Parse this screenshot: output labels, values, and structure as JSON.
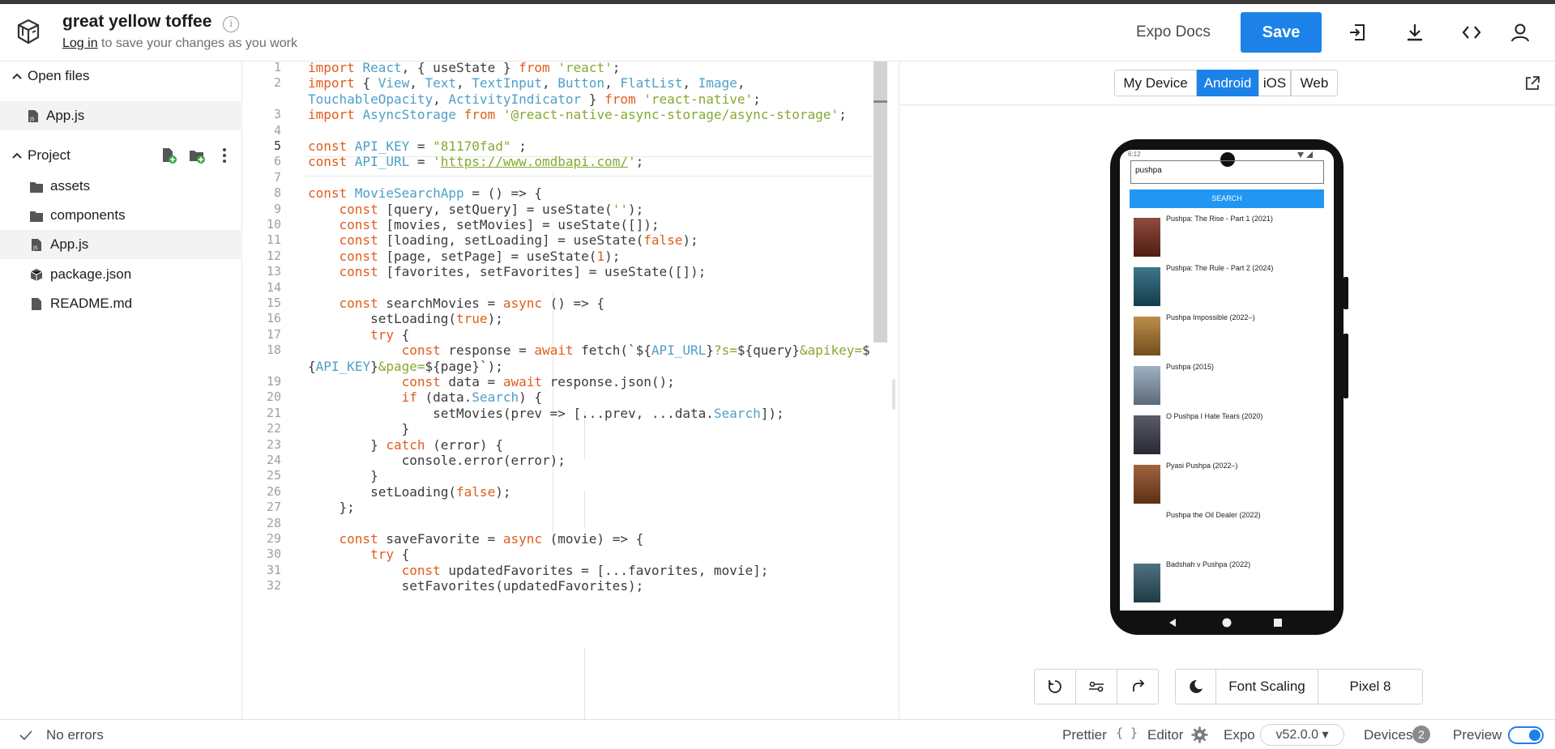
{
  "header": {
    "project_title": "great yellow toffee",
    "info_glyph": "i",
    "login_link": "Log in",
    "login_suffix": " to save your changes as you work",
    "docs_label": "Expo Docs",
    "save_label": "Save",
    "icons": [
      "sign-in-icon",
      "download-icon",
      "embed-code-icon",
      "user-icon"
    ]
  },
  "sidebar": {
    "open_files_label": "Open files",
    "open_files": [
      {
        "name": "App.js",
        "icon": "js-file-icon"
      }
    ],
    "project_label": "Project",
    "project_actions": [
      "new-file-icon",
      "new-folder-icon",
      "more-options-icon"
    ],
    "project_items": [
      {
        "name": "assets",
        "icon": "folder-icon"
      },
      {
        "name": "components",
        "icon": "folder-icon"
      },
      {
        "name": "App.js",
        "icon": "js-file-icon",
        "selected": true
      },
      {
        "name": "package.json",
        "icon": "package-icon"
      },
      {
        "name": "README.md",
        "icon": "markdown-file-icon"
      }
    ]
  },
  "editor": {
    "active_line": "5",
    "lines": [
      {
        "n": "1",
        "tokens": [
          [
            "k",
            "import "
          ],
          [
            "v",
            "React"
          ],
          [
            "p",
            ", { useState } "
          ],
          [
            "k",
            "from "
          ],
          [
            "s",
            "'react'"
          ],
          [
            "p",
            ";"
          ]
        ]
      },
      {
        "n": "2",
        "tokens": [
          [
            "k",
            "import "
          ],
          [
            "p",
            "{ "
          ],
          [
            "v",
            "View"
          ],
          [
            "p",
            ", "
          ],
          [
            "v",
            "Text"
          ],
          [
            "p",
            ", "
          ],
          [
            "v",
            "TextInput"
          ],
          [
            "p",
            ", "
          ],
          [
            "v",
            "Button"
          ],
          [
            "p",
            ", "
          ],
          [
            "v",
            "FlatList"
          ],
          [
            "p",
            ", "
          ],
          [
            "v",
            "Image"
          ],
          [
            "p",
            ","
          ]
        ]
      },
      {
        "n": "",
        "tokens": [
          [
            "v",
            "TouchableOpacity"
          ],
          [
            "p",
            ", "
          ],
          [
            "v",
            "ActivityIndicator"
          ],
          [
            "p",
            " } "
          ],
          [
            "k",
            "from "
          ],
          [
            "s",
            "'react-native'"
          ],
          [
            "p",
            ";"
          ]
        ]
      },
      {
        "n": "3",
        "tokens": [
          [
            "k",
            "import "
          ],
          [
            "v",
            "AsyncStorage "
          ],
          [
            "k",
            "from "
          ],
          [
            "s",
            "'@react-native-async-storage/async-storage'"
          ],
          [
            "p",
            ";"
          ]
        ]
      },
      {
        "n": "4",
        "tokens": []
      },
      {
        "n": "5",
        "tokens": [
          [
            "k",
            "const "
          ],
          [
            "v",
            "API_KEY "
          ],
          [
            "p",
            "= "
          ],
          [
            "s",
            "\"81170fad\""
          ],
          [
            "p",
            " ;"
          ]
        ]
      },
      {
        "n": "6",
        "tokens": [
          [
            "k",
            "const "
          ],
          [
            "v",
            "API_URL "
          ],
          [
            "p",
            "= "
          ],
          [
            "s",
            "'"
          ],
          [
            "u",
            "https://www.omdbapi.com/"
          ],
          [
            "s",
            "'"
          ],
          [
            "p",
            ";"
          ]
        ]
      },
      {
        "n": "7",
        "tokens": []
      },
      {
        "n": "8",
        "tokens": [
          [
            "k",
            "const "
          ],
          [
            "v",
            "MovieSearchApp "
          ],
          [
            "p",
            "= () => {"
          ]
        ]
      },
      {
        "n": "9",
        "tokens": [
          [
            "p",
            "    "
          ],
          [
            "k",
            "const "
          ],
          [
            "p",
            "[query, setQuery] = useState("
          ],
          [
            "s",
            "''"
          ],
          [
            "p",
            ");"
          ]
        ]
      },
      {
        "n": "10",
        "tokens": [
          [
            "p",
            "    "
          ],
          [
            "k",
            "const "
          ],
          [
            "p",
            "[movies, setMovies] = useState([]);"
          ]
        ]
      },
      {
        "n": "11",
        "tokens": [
          [
            "p",
            "    "
          ],
          [
            "k",
            "const "
          ],
          [
            "p",
            "[loading, setLoading] = useState("
          ],
          [
            "n",
            "false"
          ],
          [
            "p",
            ");"
          ]
        ]
      },
      {
        "n": "12",
        "tokens": [
          [
            "p",
            "    "
          ],
          [
            "k",
            "const "
          ],
          [
            "p",
            "[page, setPage] = useState("
          ],
          [
            "n",
            "1"
          ],
          [
            "p",
            ");"
          ]
        ]
      },
      {
        "n": "13",
        "tokens": [
          [
            "p",
            "    "
          ],
          [
            "k",
            "const "
          ],
          [
            "p",
            "[favorites, setFavorites] = useState([]);"
          ]
        ]
      },
      {
        "n": "14",
        "tokens": []
      },
      {
        "n": "15",
        "tokens": [
          [
            "p",
            "    "
          ],
          [
            "k",
            "const "
          ],
          [
            "p",
            "searchMovies = "
          ],
          [
            "k",
            "async "
          ],
          [
            "p",
            "() => {"
          ]
        ]
      },
      {
        "n": "16",
        "tokens": [
          [
            "p",
            "        setLoading("
          ],
          [
            "n",
            "true"
          ],
          [
            "p",
            ");"
          ]
        ]
      },
      {
        "n": "17",
        "tokens": [
          [
            "p",
            "        "
          ],
          [
            "k",
            "try "
          ],
          [
            "p",
            "{"
          ]
        ]
      },
      {
        "n": "18",
        "tokens": [
          [
            "p",
            "            "
          ],
          [
            "k",
            "const "
          ],
          [
            "p",
            "response = "
          ],
          [
            "k",
            "await "
          ],
          [
            "p",
            "fetch(`${"
          ],
          [
            "v",
            "API_URL"
          ],
          [
            "p",
            "}"
          ],
          [
            "s",
            "?s="
          ],
          [
            "p",
            "${query}"
          ],
          [
            "s",
            "&apikey="
          ],
          [
            "p",
            "$"
          ]
        ]
      },
      {
        "n": "",
        "tokens": [
          [
            "p",
            "{"
          ],
          [
            "v",
            "API_KEY"
          ],
          [
            "p",
            "}"
          ],
          [
            "s",
            "&page="
          ],
          [
            "p",
            "${page}`);"
          ]
        ]
      },
      {
        "n": "19",
        "tokens": [
          [
            "p",
            "            "
          ],
          [
            "k",
            "const "
          ],
          [
            "p",
            "data = "
          ],
          [
            "k",
            "await "
          ],
          [
            "p",
            "response.json();"
          ]
        ]
      },
      {
        "n": "20",
        "tokens": [
          [
            "p",
            "            "
          ],
          [
            "k",
            "if "
          ],
          [
            "p",
            "(data."
          ],
          [
            "v",
            "Search"
          ],
          [
            "p",
            ") {"
          ]
        ]
      },
      {
        "n": "21",
        "tokens": [
          [
            "p",
            "                setMovies(prev => [...prev, ...data."
          ],
          [
            "v",
            "Search"
          ],
          [
            "p",
            "]);"
          ]
        ]
      },
      {
        "n": "22",
        "tokens": [
          [
            "p",
            "            }"
          ]
        ]
      },
      {
        "n": "23",
        "tokens": [
          [
            "p",
            "        } "
          ],
          [
            "k",
            "catch "
          ],
          [
            "p",
            "(error) {"
          ]
        ]
      },
      {
        "n": "24",
        "tokens": [
          [
            "p",
            "            console.error(error);"
          ]
        ]
      },
      {
        "n": "25",
        "tokens": [
          [
            "p",
            "        }"
          ]
        ]
      },
      {
        "n": "26",
        "tokens": [
          [
            "p",
            "        setLoading("
          ],
          [
            "n",
            "false"
          ],
          [
            "p",
            ");"
          ]
        ]
      },
      {
        "n": "27",
        "tokens": [
          [
            "p",
            "    };"
          ]
        ]
      },
      {
        "n": "28",
        "tokens": []
      },
      {
        "n": "29",
        "tokens": [
          [
            "p",
            "    "
          ],
          [
            "k",
            "const "
          ],
          [
            "p",
            "saveFavorite = "
          ],
          [
            "k",
            "async "
          ],
          [
            "p",
            "(movie) => {"
          ]
        ]
      },
      {
        "n": "30",
        "tokens": [
          [
            "p",
            "        "
          ],
          [
            "k",
            "try "
          ],
          [
            "p",
            "{"
          ]
        ]
      },
      {
        "n": "31",
        "tokens": [
          [
            "p",
            "            "
          ],
          [
            "k",
            "const "
          ],
          [
            "p",
            "updatedFavorites = [...favorites, movie];"
          ]
        ]
      },
      {
        "n": "32",
        "tokens": [
          [
            "p",
            "            setFavorites(updatedFavorites);"
          ]
        ]
      }
    ]
  },
  "preview": {
    "platform_tabs": [
      {
        "label": "My Device",
        "active": false
      },
      {
        "label": "Android",
        "active": true
      },
      {
        "label": "iOS",
        "active": false
      },
      {
        "label": "Web",
        "active": false
      }
    ],
    "device": {
      "status_time": "6:12",
      "search_value": "pushpa",
      "search_button": "SEARCH",
      "movies": [
        {
          "title": "Pushpa: The Rise - Part 1 (2021)",
          "poster_color": "#7a2d1c",
          "has_poster": true
        },
        {
          "title": "Pushpa: The Rule - Part 2 (2024)",
          "poster_color": "#1d5e74",
          "has_poster": true
        },
        {
          "title": "Pushpa Impossible (2022–)",
          "poster_color": "#b07a2a",
          "has_poster": true
        },
        {
          "title": "Pushpa (2015)",
          "poster_color": "#8ea3b8",
          "has_poster": true
        },
        {
          "title": "O Pushpa I Hate Tears (2020)",
          "poster_color": "#3d3f4e",
          "has_poster": true
        },
        {
          "title": "Pyasi Pushpa (2022–)",
          "poster_color": "#8e4a1e",
          "has_poster": true
        },
        {
          "title": "Pushpa the Oil Dealer (2022)",
          "poster_color": "#ffffff",
          "has_poster": false
        },
        {
          "title": "Badshah v Pushpa (2022)",
          "poster_color": "#2f5a6a",
          "has_poster": true
        }
      ]
    },
    "controls": {
      "font_scaling": "Font Scaling",
      "device_name": "Pixel 8"
    }
  },
  "footer": {
    "status": "No errors",
    "prettier": "Prettier",
    "prettier_glyph": "{ }",
    "editor": "Editor",
    "expo": "Expo",
    "sdk_version": "v52.0.0 ▾",
    "devices": "Devices",
    "devices_count": "2",
    "preview": "Preview"
  },
  "colors": {
    "accent": "#1d82e8",
    "keyword": "#e05d1a",
    "identifier": "#4e9fc7",
    "string": "#86a832"
  }
}
